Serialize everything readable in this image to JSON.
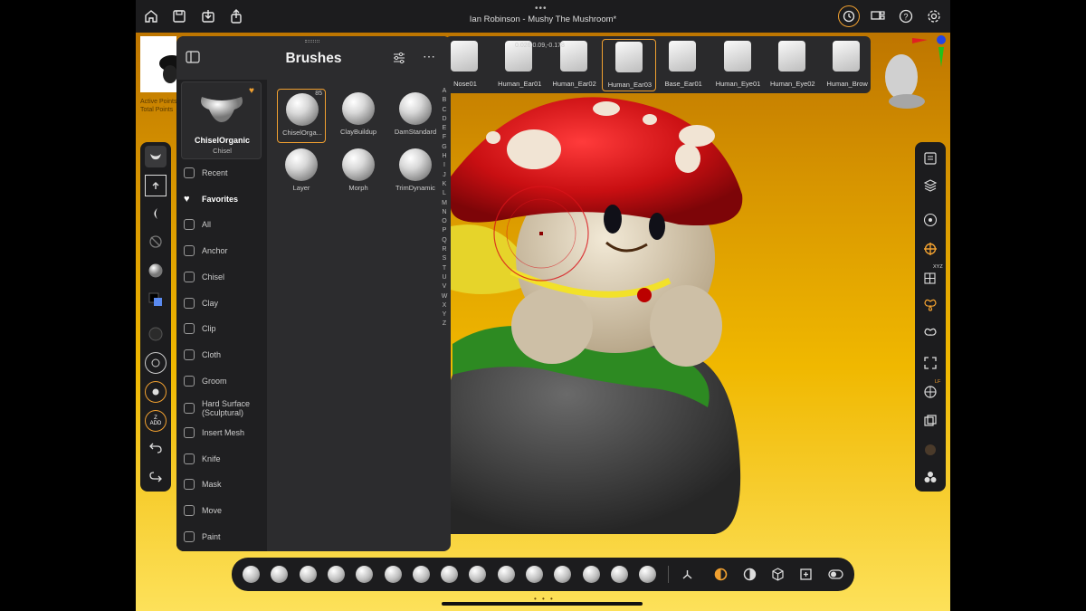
{
  "window": {
    "title": "Ian Robinson - Mushy The Mushroom*",
    "menu_dots": "•••"
  },
  "topbar": {
    "left_icons": [
      "home-icon",
      "save-icon",
      "import-icon",
      "share-icon"
    ],
    "right_icons": [
      "history-icon",
      "layout-icon",
      "help-icon",
      "settings-icon"
    ]
  },
  "stats": {
    "active_points": "Active Points",
    "total_points": "Total Points"
  },
  "coordinates": "0.026,0.09,-0.178",
  "panel": {
    "title": "Brushes",
    "current_brush": {
      "name": "ChiselOrganic",
      "category": "Chisel"
    },
    "categories": [
      {
        "label": "Recent",
        "icon": "recent-icon"
      },
      {
        "label": "Favorites",
        "icon": "heart-icon"
      },
      {
        "label": "All",
        "icon": "grid-icon"
      },
      {
        "label": "Anchor",
        "icon": "anchor-icon"
      },
      {
        "label": "Chisel",
        "icon": "chisel-icon"
      },
      {
        "label": "Clay",
        "icon": "clay-icon"
      },
      {
        "label": "Clip",
        "icon": "clip-icon"
      },
      {
        "label": "Cloth",
        "icon": "cloth-icon"
      },
      {
        "label": "Groom",
        "icon": "groom-icon"
      },
      {
        "label": "Hard Surface (Sculptural)",
        "icon": "hard-surface-icon"
      },
      {
        "label": "Insert Mesh",
        "icon": "insert-mesh-icon"
      },
      {
        "label": "Knife",
        "icon": "knife-icon"
      },
      {
        "label": "Mask",
        "icon": "mask-icon"
      },
      {
        "label": "Move",
        "icon": "move-icon"
      },
      {
        "label": "Paint",
        "icon": "paint-icon"
      }
    ],
    "brushes": [
      {
        "label": "ChiselOrga...",
        "badge": "85"
      },
      {
        "label": "ClayBuildup"
      },
      {
        "label": "DamStandard"
      },
      {
        "label": "Layer"
      },
      {
        "label": "Morph"
      },
      {
        "label": "TrimDynamic"
      }
    ],
    "alphabet": [
      "A",
      "B",
      "C",
      "D",
      "E",
      "F",
      "G",
      "H",
      "I",
      "J",
      "K",
      "L",
      "M",
      "N",
      "O",
      "P",
      "Q",
      "R",
      "S",
      "T",
      "U",
      "V",
      "W",
      "X",
      "Y",
      "Z"
    ]
  },
  "shelf": {
    "items": [
      "Nose01",
      "Human_Ear01",
      "Human_Ear02",
      "Human_Ear03",
      "Base_Ear01",
      "Human_Eye01",
      "Human_Eye02",
      "Human_Brow"
    ],
    "selected": "Human_Ear03"
  },
  "left_toolbar": {
    "buttons": [
      "brush-icon",
      "stroke-icon",
      "alpha-icon",
      "texture-off-icon",
      "material-icon",
      "color-icon",
      "size-icon",
      "intensity-icon",
      "focal-icon",
      "zadd-icon",
      "undo-icon",
      "redo-icon"
    ],
    "zadd_label": "Z\nADD"
  },
  "right_toolbar": {
    "buttons": [
      "panel-icon",
      "layers-icon",
      "gizmo-icon",
      "transform-icon",
      "xyz-icon",
      "symmetry-icon",
      "radial-icon",
      "frame-icon",
      "perspective-icon",
      "floor-icon",
      "material-icon",
      "solo-icon"
    ],
    "xyz_label": "XYZ",
    "lf_label": "LF"
  },
  "colors": {
    "accent": "#f0a030",
    "panel_bg": "#2c2c2e",
    "toolbar_bg": "#1c1c1e"
  }
}
